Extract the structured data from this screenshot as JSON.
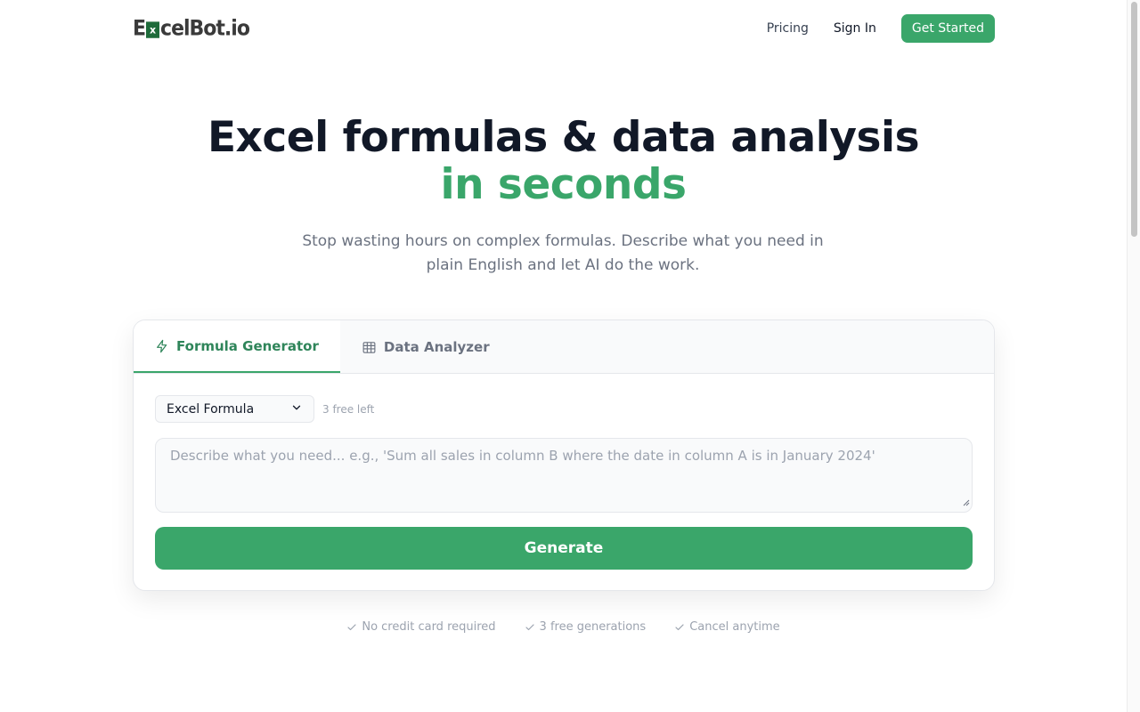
{
  "brand": {
    "logo_prefix": "E",
    "logo_x": "x",
    "logo_suffix": "celBot.io",
    "accent_color": "#3aa66a"
  },
  "nav": {
    "pricing": "Pricing",
    "sign_in": "Sign In",
    "get_started": "Get Started"
  },
  "hero": {
    "title_line1": "Excel formulas & data analysis",
    "title_line2": "in seconds",
    "subtitle": "Stop wasting hours on complex formulas. Describe what you need in plain English and let AI do the work."
  },
  "tabs": [
    {
      "label": "Formula Generator",
      "icon": "lightning-icon",
      "active": true
    },
    {
      "label": "Data Analyzer",
      "icon": "table-icon",
      "active": false
    }
  ],
  "form": {
    "select_value": "Excel Formula",
    "free_left": "3 free left",
    "placeholder": "Describe what you need... e.g., 'Sum all sales in column B where the date in column A is in January 2024'",
    "generate_label": "Generate"
  },
  "features": [
    {
      "label": "No credit card required",
      "icon": "check-icon"
    },
    {
      "label": "3 free generations",
      "icon": "check-icon"
    },
    {
      "label": "Cancel anytime",
      "icon": "check-icon"
    }
  ]
}
